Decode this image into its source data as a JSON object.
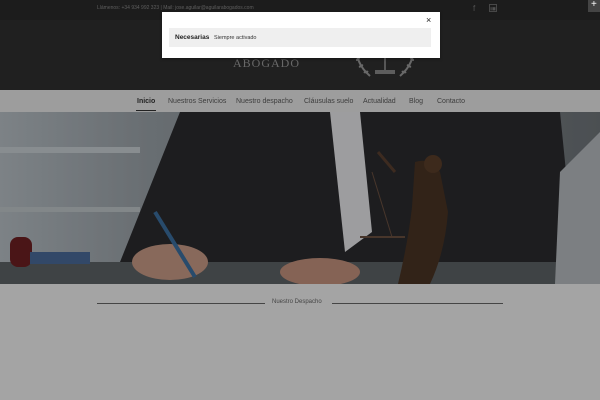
{
  "topbar": {
    "contact": "Llámenos: +34 934 992 323 | Mail: jose.aguilar@aguilarabogados.com",
    "icons": [
      "facebook-icon",
      "linkedin-icon"
    ]
  },
  "header": {
    "brand_title": "ABOGADO",
    "emblem_icon": "laurel-scales-icon"
  },
  "nav": {
    "items": [
      {
        "label": "Inicio",
        "active": true
      },
      {
        "label": "Nuestros Servicios"
      },
      {
        "label": "Nuestro despacho"
      },
      {
        "label": "Cláusulas suelo"
      },
      {
        "label": "Actualidad"
      },
      {
        "label": "Blog"
      },
      {
        "label": "Contacto"
      }
    ]
  },
  "hero": {
    "image": "lawyer-signing-document-with-justice-statue"
  },
  "section": {
    "title": "Nuestro Despacho"
  },
  "cookie_modal": {
    "row_label": "Necesarias",
    "row_status": "Siempre activado",
    "close_symbol": "×"
  },
  "corner_button": {
    "symbol": "+"
  }
}
